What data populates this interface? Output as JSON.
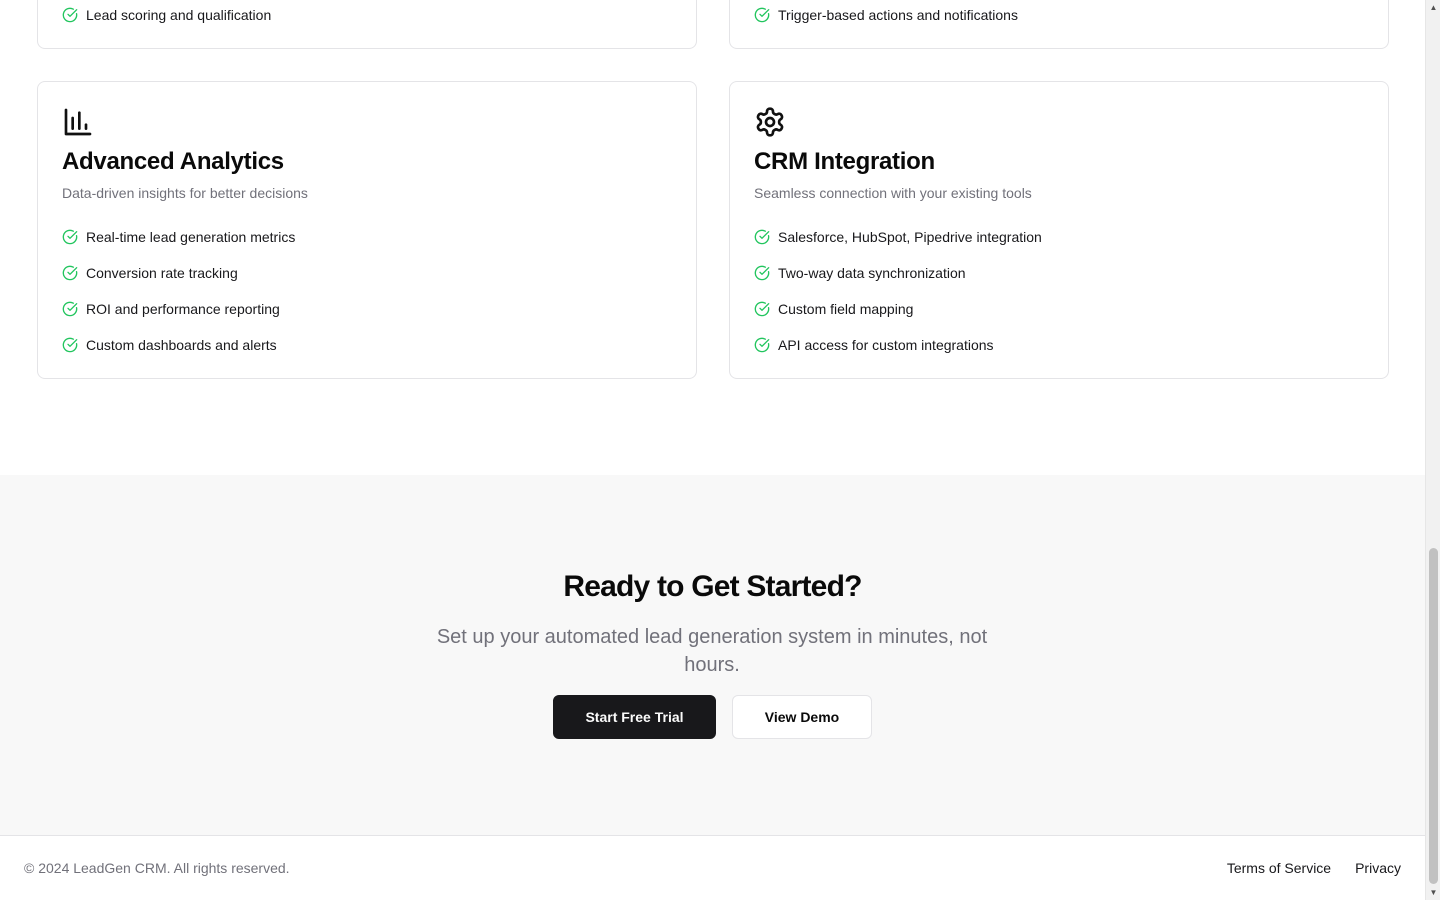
{
  "previous_cards": {
    "left_item": "Lead scoring and qualification",
    "right_item": "Trigger-based actions and notifications"
  },
  "cards": [
    {
      "icon": "bar-chart-icon",
      "title": "Advanced Analytics",
      "subtitle": "Data-driven insights for better decisions",
      "features": [
        "Real-time lead generation metrics",
        "Conversion rate tracking",
        "ROI and performance reporting",
        "Custom dashboards and alerts"
      ]
    },
    {
      "icon": "gear-icon",
      "title": "CRM Integration",
      "subtitle": "Seamless connection with your existing tools",
      "features": [
        "Salesforce, HubSpot, Pipedrive integration",
        "Two-way data synchronization",
        "Custom field mapping",
        "API access for custom integrations"
      ]
    }
  ],
  "cta": {
    "title": "Ready to Get Started?",
    "subtitle": "Set up your automated lead generation system in minutes, not hours.",
    "primary_button": "Start Free Trial",
    "secondary_button": "View Demo"
  },
  "footer": {
    "copyright": "© 2024 LeadGen CRM. All rights reserved.",
    "links": [
      "Terms of Service",
      "Privacy"
    ]
  },
  "colors": {
    "check": "#22c55e",
    "primary_button_bg": "#18181b",
    "cta_bg": "#f8f8f8",
    "muted_text": "#71717a"
  },
  "scrollbar": {
    "up_icon": "triangle-up-icon",
    "down_icon": "triangle-down-icon"
  }
}
